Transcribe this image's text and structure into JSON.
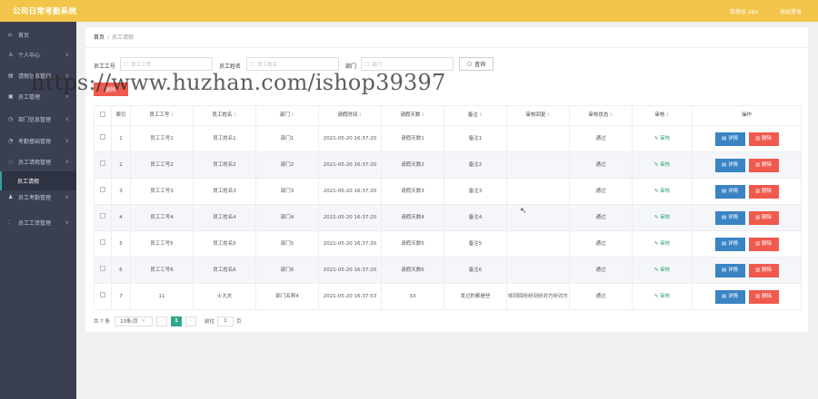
{
  "header": {
    "app_title": "公司日常考勤系统",
    "user_label": "管理员 abo",
    "logout_label": "退出登录"
  },
  "sidebar": {
    "items": [
      {
        "icon": "home-icon",
        "glyph": "⌂",
        "label": "首页",
        "arrow": ""
      },
      {
        "icon": "user-icon",
        "glyph": "♙",
        "label": "个人中心",
        "arrow": "∨"
      },
      {
        "icon": "menu-icon",
        "glyph": "▤",
        "label": "请假信息管理",
        "arrow": "∨"
      },
      {
        "icon": "id-icon",
        "glyph": "▣",
        "label": "员工管理",
        "arrow": "∨"
      },
      {
        "icon": "dept-icon",
        "glyph": "◷",
        "label": "部门信息管理",
        "arrow": "∨"
      },
      {
        "icon": "clock-icon",
        "glyph": "◔",
        "label": "考勤基础管理",
        "arrow": "∨"
      },
      {
        "icon": "leave-icon",
        "glyph": "◌",
        "label": "员工请假管理",
        "arrow": "∧"
      },
      {
        "icon": "people-icon",
        "glyph": "♟",
        "label": "员工考勤管理",
        "arrow": "∨"
      },
      {
        "icon": "salary-icon",
        "glyph": "⁚",
        "label": "员工工资管理",
        "arrow": "∨"
      }
    ],
    "subitem": "员工请假"
  },
  "breadcrumb": {
    "home": "首页",
    "sep": "/",
    "current": "员工请假"
  },
  "filters": {
    "emp_no_label": "员工工号",
    "emp_no_placeholder": "员工工号",
    "emp_name_label": "员工姓名",
    "emp_name_placeholder": "员工姓名",
    "dept_label": "部门",
    "dept_placeholder": "部门",
    "search_label": "查询",
    "delete_label": "删除"
  },
  "table": {
    "headers": [
      "索引",
      "员工工号",
      "员工姓名",
      "部门",
      "请假时间",
      "请假天数",
      "备注",
      "审核回复",
      "审核状态",
      "审核",
      "操作"
    ],
    "audit_label": "审核",
    "detail_label": "详情",
    "delete_label": "删除",
    "rows": [
      {
        "index": "1",
        "emp_no": "员工工号1",
        "name": "员工姓名1",
        "dept": "部门1",
        "time": "2021-05-20 16:37:20",
        "days": "请假天数1",
        "note": "备注1",
        "reply": "",
        "status": "通过"
      },
      {
        "index": "2",
        "emp_no": "员工工号2",
        "name": "员工姓名2",
        "dept": "部门2",
        "time": "2021-05-20 16:37:20",
        "days": "请假天数2",
        "note": "备注2",
        "reply": "",
        "status": "通过"
      },
      {
        "index": "3",
        "emp_no": "员工工号3",
        "name": "员工姓名3",
        "dept": "部门3",
        "time": "2021-05-20 16:37:20",
        "days": "请假天数3",
        "note": "备注3",
        "reply": "",
        "status": "通过"
      },
      {
        "index": "4",
        "emp_no": "员工工号4",
        "name": "员工姓名4",
        "dept": "部门4",
        "time": "2021-05-20 16:37:20",
        "days": "请假天数4",
        "note": "备注4",
        "reply": "",
        "status": "通过"
      },
      {
        "index": "5",
        "emp_no": "员工工号5",
        "name": "员工姓名5",
        "dept": "部门5",
        "time": "2021-05-20 16:37:20",
        "days": "请假天数5",
        "note": "备注5",
        "reply": "",
        "status": "通过"
      },
      {
        "index": "6",
        "emp_no": "员工工号6",
        "name": "员工姓名6",
        "dept": "部门6",
        "time": "2021-05-20 16:37:20",
        "days": "请假天数6",
        "note": "备注6",
        "reply": "",
        "status": "通过"
      },
      {
        "index": "7",
        "emp_no": "11",
        "name": "士大夫",
        "dept": "部门名称4",
        "time": "2021-05-20 16:37:53",
        "days": "33",
        "note": "发过的都是些",
        "reply": "收到回纷纷到纷对方纷对方",
        "status": "通过"
      }
    ]
  },
  "pagination": {
    "total": "共 7 条",
    "page_size": "10条/页",
    "prev": "‹",
    "current": "1",
    "next": "›",
    "goto_label": "前往",
    "goto_value": "1",
    "page_unit": "页"
  },
  "watermark": "https://www.huzhan.com/ishop39397"
}
